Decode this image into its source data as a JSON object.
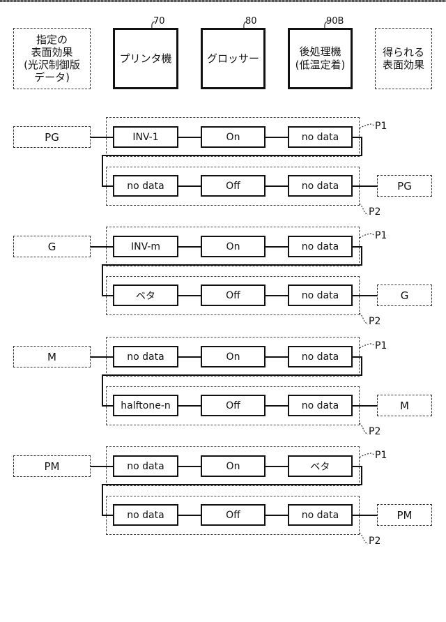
{
  "header": {
    "input_label": "指定の\n表面効果\n(光沢制御版\nデータ)",
    "devices": [
      {
        "ref": "70",
        "label": "プリンタ機"
      },
      {
        "ref": "80",
        "label": "グロッサー"
      },
      {
        "ref": "90B",
        "label": "後処理機\n(低温定着)"
      }
    ],
    "output_label": "得られる\n表面効果"
  },
  "pass_labels": {
    "first": "P1",
    "second": "P2"
  },
  "rows": [
    {
      "input": "PG",
      "p1": [
        "INV-1",
        "On",
        "no data"
      ],
      "p2": [
        "no data",
        "Off",
        "no data"
      ],
      "output": "PG"
    },
    {
      "input": "G",
      "p1": [
        "INV-m",
        "On",
        "no data"
      ],
      "p2": [
        "ベタ",
        "Off",
        "no data"
      ],
      "output": "G"
    },
    {
      "input": "M",
      "p1": [
        "no data",
        "On",
        "no data"
      ],
      "p2": [
        "halftone-n",
        "Off",
        "no data"
      ],
      "output": "M"
    },
    {
      "input": "PM",
      "p1": [
        "no data",
        "On",
        "ベタ"
      ],
      "p2": [
        "no data",
        "Off",
        "no data"
      ],
      "output": "PM"
    }
  ]
}
